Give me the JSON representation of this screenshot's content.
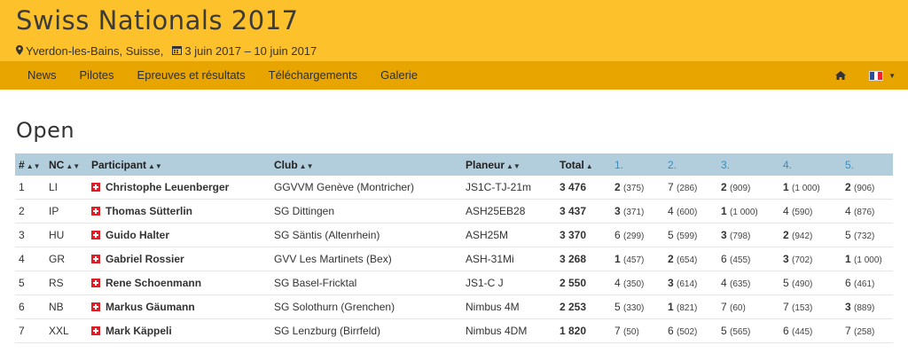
{
  "header": {
    "title": "Swiss Nationals 2017",
    "location": "Yverdon-les-Bains, Suisse,",
    "dates": "3 juin 2017 – 10 juin 2017",
    "location_icon": "map-marker-icon",
    "calendar_icon": "calendar-icon"
  },
  "nav": {
    "items": [
      "News",
      "Pilotes",
      "Epreuves et résultats",
      "Téléchargements",
      "Galerie"
    ],
    "home_icon": "home-icon",
    "language_flag": "flag-fr-icon"
  },
  "section": {
    "title": "Open"
  },
  "table": {
    "headers": {
      "rank": "#",
      "nc": "NC",
      "participant": "Participant",
      "club": "Club",
      "planeur": "Planeur",
      "total": "Total",
      "d1": "1.",
      "d2": "2.",
      "d3": "3.",
      "d4": "4.",
      "d5": "5."
    },
    "rows": [
      {
        "rank": "1",
        "nc": "LI",
        "name": "Christophe Leuenberger",
        "club": "GGVVM Genève (Montricher)",
        "planeur": "JS1C-TJ-21m",
        "total": "3 476",
        "d1r": "2",
        "d1p": "(375)",
        "d2r": "7",
        "d2p": "(286)",
        "d3r": "2",
        "d3p": "(909)",
        "d4r": "1",
        "d4p": "(1 000)",
        "d5r": "2",
        "d5p": "(906)"
      },
      {
        "rank": "2",
        "nc": "IP",
        "name": "Thomas Sütterlin",
        "club": "SG Dittingen",
        "planeur": "ASH25EB28",
        "total": "3 437",
        "d1r": "3",
        "d1p": "(371)",
        "d2r": "4",
        "d2p": "(600)",
        "d3r": "1",
        "d3p": "(1 000)",
        "d4r": "4",
        "d4p": "(590)",
        "d5r": "4",
        "d5p": "(876)"
      },
      {
        "rank": "3",
        "nc": "HU",
        "name": "Guido Halter",
        "club": "SG Säntis (Altenrhein)",
        "planeur": "ASH25M",
        "total": "3 370",
        "d1r": "6",
        "d1p": "(299)",
        "d2r": "5",
        "d2p": "(599)",
        "d3r": "3",
        "d3p": "(798)",
        "d4r": "2",
        "d4p": "(942)",
        "d5r": "5",
        "d5p": "(732)"
      },
      {
        "rank": "4",
        "nc": "GR",
        "name": "Gabriel Rossier",
        "club": "GVV Les Martinets (Bex)",
        "planeur": "ASH-31Mi",
        "total": "3 268",
        "d1r": "1",
        "d1p": "(457)",
        "d2r": "2",
        "d2p": "(654)",
        "d3r": "6",
        "d3p": "(455)",
        "d4r": "3",
        "d4p": "(702)",
        "d5r": "1",
        "d5p": "(1 000)"
      },
      {
        "rank": "5",
        "nc": "RS",
        "name": "Rene Schoenmann",
        "club": "SG Basel-Fricktal",
        "planeur": "JS1-C J",
        "total": "2 550",
        "d1r": "4",
        "d1p": "(350)",
        "d2r": "3",
        "d2p": "(614)",
        "d3r": "4",
        "d3p": "(635)",
        "d4r": "5",
        "d4p": "(490)",
        "d5r": "6",
        "d5p": "(461)"
      },
      {
        "rank": "6",
        "nc": "NB",
        "name": "Markus Gäumann",
        "club": "SG Solothurn (Grenchen)",
        "planeur": "Nimbus 4M",
        "total": "2 253",
        "d1r": "5",
        "d1p": "(330)",
        "d2r": "1",
        "d2p": "(821)",
        "d3r": "7",
        "d3p": "(60)",
        "d4r": "7",
        "d4p": "(153)",
        "d5r": "3",
        "d5p": "(889)"
      },
      {
        "rank": "7",
        "nc": "XXL",
        "name": "Mark Käppeli",
        "club": "SG Lenzburg (Birrfeld)",
        "planeur": "Nimbus 4DM",
        "total": "1 820",
        "d1r": "7",
        "d1p": "(50)",
        "d2r": "6",
        "d2p": "(502)",
        "d3r": "5",
        "d3p": "(565)",
        "d4r": "6",
        "d4p": "(445)",
        "d5r": "7",
        "d5p": "(258)"
      }
    ],
    "bold_day_ranks": [
      "1",
      "2",
      "3"
    ]
  },
  "colors": {
    "header_bg": "#FDC12B",
    "nav_bg": "#E8A500",
    "table_header_bg": "#B2CDDB",
    "link": "#3c8dbc"
  }
}
